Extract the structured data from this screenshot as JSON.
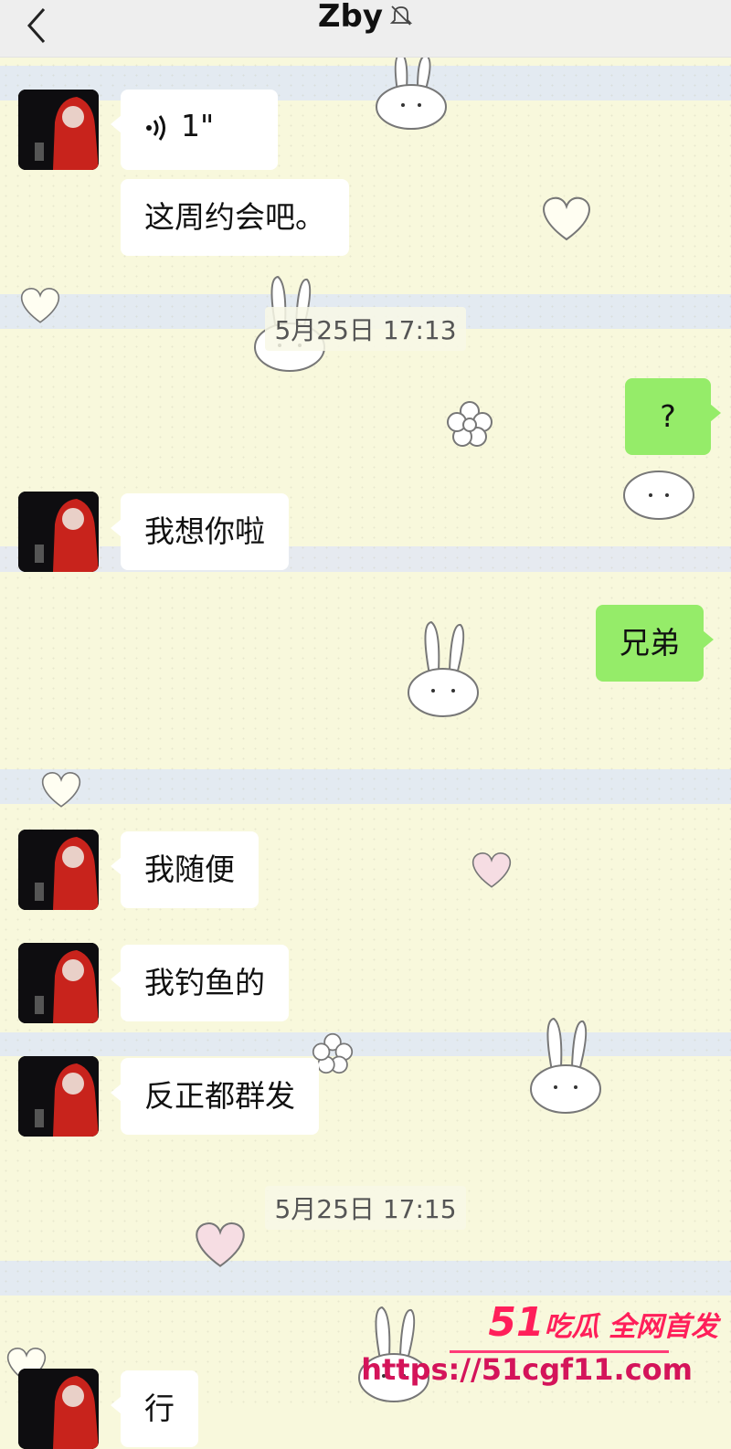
{
  "header": {
    "contact_name": "Zby",
    "back_icon": "chevron-left-icon",
    "mute_icon": "bell-muted-icon"
  },
  "messages": {
    "m1_voice_duration": "1\"",
    "m2_text": "这周约会吧。",
    "ts1": "5月25日 17:13",
    "m3_text": "?",
    "m4_text": "我想你啦",
    "m5_text": "兄弟",
    "m6_text": "我随便",
    "m7_text": "我钓鱼的",
    "m8_text": "反正都群发",
    "ts2": "5月25日 17:15",
    "m9_text": "行"
  },
  "watermark": {
    "brand_number": "51",
    "brand_text": "吃瓜 全网首发",
    "url": "https://51cgf11.com"
  },
  "colors": {
    "incoming_bubble": "#ffffff",
    "outgoing_bubble": "#95ec69",
    "header_bg": "#eeeeee",
    "watermark": "#ff1f5a"
  }
}
